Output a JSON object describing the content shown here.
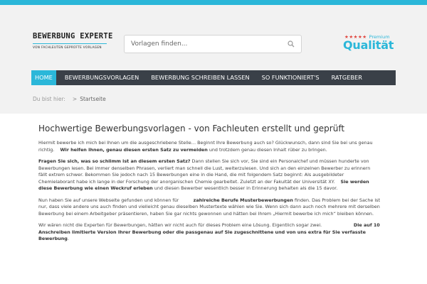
{
  "header": {
    "logo_title": "BEWERBUNG EXPERTE",
    "logo_subtitle": "VON FACHLEUTEN GEPRÜFTE VORLAGEN",
    "search_placeholder": "Vorlagen finden...",
    "quality_stars": "★★★★★",
    "quality_premium": "Premium",
    "quality_word": "Qualität"
  },
  "nav": {
    "items": [
      {
        "label": "HOME",
        "active": true
      },
      {
        "label": "BEWERBUNGSVORLAGEN"
      },
      {
        "label": "BEWERBUNG SCHREIBEN LASSEN"
      },
      {
        "label": "SO FUNKTIONIERT'S"
      },
      {
        "label": "RATGEBER"
      }
    ]
  },
  "breadcrumb": {
    "prefix": "Du bist hier:",
    "separator": ">",
    "current": "Startseite"
  },
  "main": {
    "title": "Hochwertige Bewerbungsvorlagen - von Fachleuten erstellt und geprüft",
    "p1_a": "Hiermit bewerbe ich mich bei Ihnen um die ausgeschriebene Stelle… Beginnt Ihre Bewerbung auch so? Glückwunsch, dann sind Sie bei uns genau richtig.",
    "p1_b": "Wir helfen Ihnen, genau diesen ersten Satz zu vermeiden",
    "p1_c": " und trotzdem genau diesen Inhalt rüber zu bringen.",
    "p2_a": "Fragen Sie sich, was so schlimm ist an diesem ersten Satz?",
    "p2_b": " Dann stellen Sie sich vor, Sie sind ein Personalchef und müssen hunderte von Bewerbungen lesen. Bei immer denselben Phrasen, verliert man schnell die Lust, weiterzulesen. Und sich an den einzelnen Bewerber zu erinnern fällt extrem schwer. Bekommen Sie jedoch nach 15 Bewerbungen eine in die Hand, die mit folgendem Satz beginnt: Als ausgebildeter Chemielaborant habe ich lange in der Forschung der anorganischen Chemie gearbeitet. Zuletzt an der Fakultät der Universität XY.",
    "p2_c": "Sie werden diese Bewerbung wie einen Weckruf erleben",
    "p2_d": " und diesen Bewerber wesentlich besser in Erinnerung behalten als die 15 davor.",
    "p3_a": "Nun haben Sie auf unsere Webseite gefunden und können für",
    "p3_b": "zahlreiche Berufe Musterbewerbungen",
    "p3_c": " finden. Das Problem bei der Sache ist nur, dass viele andere uns auch finden und vielleicht genau dieselben Mustertexte wählen wie Sie. Wenn sich dann auch noch mehrere mit derselben Bewerbung bei einem Arbeitgeber präsentieren, haben Sie gar nichts gewonnen und hätten bei Ihrem „Hiermit bewerbe ich mich“ bleiben können.",
    "p4_a": "Wir wären nicht die Experten für Bewerbungen, hätten wir nicht auch für dieses Problem eine Lösung. Eigentlich sogar zwei.",
    "p4_b": "Die auf 10 Anschreiben limitierte Version Ihrer Bewerbung oder die passgenau auf Sie zugeschnittene und von uns extra für Sie verfasste Bewerbung",
    "p4_c": "."
  },
  "colors": {
    "accent": "#2bb7d9",
    "nav_bg": "#3a4048",
    "star": "#e0443c"
  }
}
